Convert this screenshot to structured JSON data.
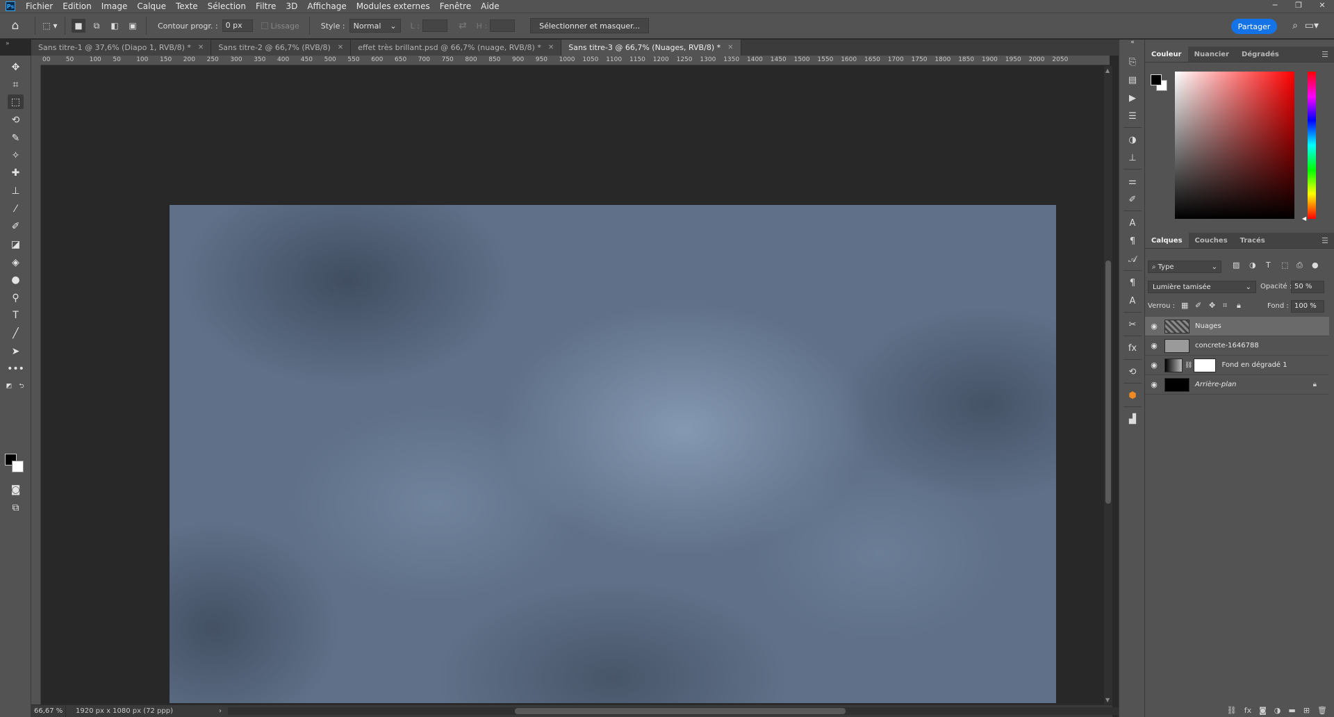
{
  "menu": {
    "logo": "Ps",
    "items": [
      "Fichier",
      "Edition",
      "Image",
      "Calque",
      "Texte",
      "Sélection",
      "Filtre",
      "3D",
      "Affichage",
      "Modules externes",
      "Fenêtre",
      "Aide"
    ]
  },
  "options": {
    "feather_label": "Contour progr. :",
    "feather_value": "0 px",
    "antialias_label": "Lissage",
    "style_label": "Style :",
    "style_value": "Normal",
    "width_label": "L :",
    "height_label": "H :",
    "select_mask_label": "Sélectionner et masquer...",
    "share_label": "Partager"
  },
  "tabs": [
    {
      "label": "Sans titre-1 @ 37,6% (Diapo 1, RVB/8) *"
    },
    {
      "label": "Sans titre-2 @ 66,7% (RVB/8)"
    },
    {
      "label": "effet très brillant.psd @ 66,7% (nuage, RVB/8) *"
    },
    {
      "label": "Sans titre-3 @ 66,7% (Nuages, RVB/8) *"
    }
  ],
  "ruler": {
    "labels": [
      "00",
      "50",
      "100",
      "50",
      "100",
      "150",
      "200",
      "250",
      "300",
      "350",
      "400",
      "450",
      "500",
      "550",
      "600",
      "650",
      "700",
      "750",
      "800",
      "850",
      "900",
      "950",
      "1000",
      "1050",
      "1100",
      "1150",
      "1200",
      "1250",
      "1300",
      "1350",
      "1400",
      "1450",
      "1500",
      "1550",
      "1600",
      "1650",
      "1700",
      "1750",
      "1800",
      "1850",
      "1900",
      "1950",
      "2000",
      "2050"
    ]
  },
  "status": {
    "zoom": "66,67 %",
    "doc_info": "1920 px x 1080 px (72 ppp)"
  },
  "color_panel": {
    "tabs": [
      "Couleur",
      "Nuancier",
      "Dégradés"
    ]
  },
  "layers_panel": {
    "tabs": [
      "Calques",
      "Couches",
      "Tracés"
    ],
    "filter_label": "Type",
    "blend_mode": "Lumière tamisée",
    "opacity_label": "Opacité :",
    "opacity_value": "50 %",
    "lock_label": "Verrou :",
    "fill_label": "Fond :",
    "fill_value": "100 %",
    "layers": [
      {
        "name": "Nuages"
      },
      {
        "name": "concrete-1646788"
      },
      {
        "name": "Fond en dégradé 1"
      },
      {
        "name": "Arrière-plan"
      }
    ]
  }
}
